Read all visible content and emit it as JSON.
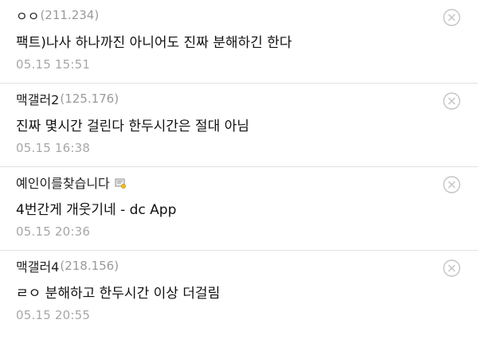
{
  "comments": [
    {
      "nickname": "ㅇㅇ",
      "ip": "(211.234)",
      "text": "팩트)나사 하나까진 아니어도 진짜 분해하긴 한다",
      "date": "05.15 15:51",
      "delete_icon": "circle-x-icon"
    },
    {
      "nickname": "맥갤러2",
      "ip": "(125.176)",
      "text": "진짜 몇시간 걸린다 한두시간은 절대 아님",
      "date": "05.15 16:38",
      "delete_icon": "circle-x-icon"
    },
    {
      "nickname": "예인이를찾습니다",
      "ip": "",
      "badge_icon": "gallery-manager-badge-icon",
      "text": "4번간게 개웃기네 - dc App",
      "date": "05.15 20:36",
      "delete_icon": "circle-x-icon"
    },
    {
      "nickname": "맥갤러4",
      "ip": "(218.156)",
      "text": "ㄹㅇ 분해하고 한두시간 이상 더걸림",
      "date": "05.15 20:55",
      "delete_icon": "circle-x-icon"
    }
  ]
}
